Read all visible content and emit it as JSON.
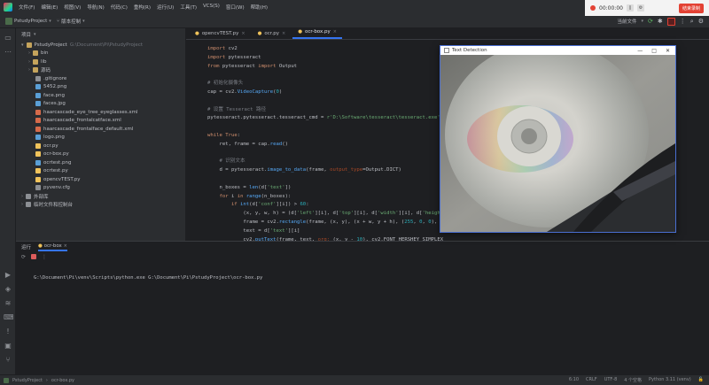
{
  "menu": {
    "items": [
      "文件(F)",
      "编辑(E)",
      "视图(V)",
      "导航(N)",
      "代码(C)",
      "重构(R)",
      "运行(U)",
      "工具(T)",
      "VCS(S)",
      "窗口(W)",
      "帮助(H)"
    ]
  },
  "toolbar": {
    "project": "PstudyProject",
    "vcs": "版本控制"
  },
  "recorder": {
    "time": "00:00:00",
    "stop_label": "结束录制"
  },
  "run_config": "当前文件",
  "project_panel": {
    "header": "项目",
    "root_name": "PstudyProject",
    "root_path": "G:\\Document\\Pi\\PstudyProject",
    "items": [
      {
        "label": "bin",
        "type": "folder"
      },
      {
        "label": "lib",
        "type": "folder"
      },
      {
        "label": "源码",
        "type": "folder"
      },
      {
        "label": ".gitignore",
        "type": "file"
      },
      {
        "label": "5452.png",
        "type": "img"
      },
      {
        "label": "face.png",
        "type": "img"
      },
      {
        "label": "faces.jpg",
        "type": "img"
      },
      {
        "label": "haarcascade_eye_tree_eyeglasses.xml",
        "type": "xml"
      },
      {
        "label": "haarcascade_frontalcatface.xml",
        "type": "xml"
      },
      {
        "label": "haarcascade_frontalface_default.xml",
        "type": "xml"
      },
      {
        "label": "logo.png",
        "type": "img"
      },
      {
        "label": "ocr.py",
        "type": "py"
      },
      {
        "label": "ocr-box.py",
        "type": "py"
      },
      {
        "label": "ocrtest.png",
        "type": "img"
      },
      {
        "label": "ocrtest.py",
        "type": "py"
      },
      {
        "label": "opencvTEST.py",
        "type": "py"
      },
      {
        "label": "pyvenv.cfg",
        "type": "cfg"
      }
    ],
    "external": "外部库",
    "scratches": "临时文件和控制台"
  },
  "editor": {
    "tabs": [
      {
        "label": "opencvTEST.py",
        "active": false
      },
      {
        "label": "ocr.py",
        "active": false
      },
      {
        "label": "ocr-box.py",
        "active": true
      }
    ],
    "lines": [
      [
        {
          "c": "kw",
          "t": "import "
        },
        {
          "c": "id",
          "t": "cv2"
        }
      ],
      [
        {
          "c": "kw",
          "t": "import "
        },
        {
          "c": "id",
          "t": "pytesseract"
        }
      ],
      [
        {
          "c": "kw",
          "t": "from "
        },
        {
          "c": "id",
          "t": "pytesseract "
        },
        {
          "c": "kw",
          "t": "import "
        },
        {
          "c": "id",
          "t": "Output"
        }
      ],
      [],
      [
        {
          "c": "cm",
          "t": "# 初始化摄像头"
        }
      ],
      [
        {
          "c": "id",
          "t": "cap = cv2."
        },
        {
          "c": "fn",
          "t": "VideoCapture"
        },
        {
          "c": "id",
          "t": "("
        },
        {
          "c": "num",
          "t": "0"
        },
        {
          "c": "id",
          "t": ")"
        }
      ],
      [],
      [
        {
          "c": "cm",
          "t": "# 设置 Tesseract 路径"
        }
      ],
      [
        {
          "c": "id",
          "t": "pytesseract.pytesseract.tesseract_cmd = "
        },
        {
          "c": "str",
          "t": "r'D:\\Software\\tesseract\\tesseract.exe'"
        }
      ],
      [],
      [
        {
          "c": "kw",
          "t": "while "
        },
        {
          "c": "kw",
          "t": "True"
        },
        {
          "c": "id",
          "t": ":"
        }
      ],
      [
        {
          "c": "id",
          "t": "    ret, frame = cap."
        },
        {
          "c": "fn",
          "t": "read"
        },
        {
          "c": "id",
          "t": "()"
        }
      ],
      [],
      [
        {
          "c": "cm",
          "t": "    # 识别文本"
        }
      ],
      [
        {
          "c": "id",
          "t": "    d = pytesseract."
        },
        {
          "c": "fn",
          "t": "image_to_data"
        },
        {
          "c": "id",
          "t": "(frame, "
        },
        {
          "c": "prm",
          "t": "output_type"
        },
        {
          "c": "id",
          "t": "=Output.DICT)"
        }
      ],
      [],
      [
        {
          "c": "id",
          "t": "    n_boxes = "
        },
        {
          "c": "fn",
          "t": "len"
        },
        {
          "c": "id",
          "t": "(d["
        },
        {
          "c": "str",
          "t": "'text'"
        },
        {
          "c": "id",
          "t": "])"
        }
      ],
      [
        {
          "c": "kw",
          "t": "    for "
        },
        {
          "c": "id",
          "t": "i "
        },
        {
          "c": "kw",
          "t": "in "
        },
        {
          "c": "fn",
          "t": "range"
        },
        {
          "c": "id",
          "t": "(n_boxes):"
        }
      ],
      [
        {
          "c": "kw",
          "t": "        if "
        },
        {
          "c": "fn",
          "t": "int"
        },
        {
          "c": "id",
          "t": "(d["
        },
        {
          "c": "str",
          "t": "'conf'"
        },
        {
          "c": "id",
          "t": "][i]) > "
        },
        {
          "c": "num",
          "t": "60"
        },
        {
          "c": "id",
          "t": ":"
        }
      ],
      [
        {
          "c": "id",
          "t": "            (x, y, w, h) = (d["
        },
        {
          "c": "str",
          "t": "'left'"
        },
        {
          "c": "id",
          "t": "][i], d["
        },
        {
          "c": "str",
          "t": "'top'"
        },
        {
          "c": "id",
          "t": "][i], d["
        },
        {
          "c": "str",
          "t": "'width'"
        },
        {
          "c": "id",
          "t": "][i], d["
        },
        {
          "c": "str",
          "t": "'height'"
        },
        {
          "c": "id",
          "t": "][i])"
        }
      ],
      [
        {
          "c": "id",
          "t": "            frame = cv2."
        },
        {
          "c": "fn",
          "t": "rectangle"
        },
        {
          "c": "id",
          "t": "(frame, (x, y), (x + w, y + h), ("
        },
        {
          "c": "num",
          "t": "255"
        },
        {
          "c": "id",
          "t": ", "
        },
        {
          "c": "num",
          "t": "0"
        },
        {
          "c": "id",
          "t": ", "
        },
        {
          "c": "num",
          "t": "0"
        },
        {
          "c": "id",
          "t": "), "
        },
        {
          "c": "num",
          "t": "2"
        },
        {
          "c": "id",
          "t": ")"
        }
      ],
      [
        {
          "c": "id",
          "t": "            text = d["
        },
        {
          "c": "str",
          "t": "'text'"
        },
        {
          "c": "id",
          "t": "][i]"
        }
      ],
      [
        {
          "c": "id",
          "t": "            cv2."
        },
        {
          "c": "fn",
          "t": "putText"
        },
        {
          "c": "id",
          "t": "(frame, text, "
        },
        {
          "c": "prm",
          "t": "org: "
        },
        {
          "c": "id",
          "t": "(x, y - "
        },
        {
          "c": "num",
          "t": "10"
        },
        {
          "c": "id",
          "t": "), cv2.FONT_HERSHEY_SIMPLEX"
        }
      ]
    ]
  },
  "bottom": {
    "tab_run": "运行",
    "tab_file": "ocr-box",
    "command": "G:\\Document\\Pi\\venv\\Scripts\\python.exe G:\\Document\\Pi\\PstudyProject\\ocr-box.py"
  },
  "status": {
    "breadcrumb_project": "PstudyProject",
    "breadcrumb_file": "ocr-box.py",
    "position": "6:10",
    "line_sep": "CRLF",
    "encoding": "UTF-8",
    "indent": "4 个空格",
    "interpreter": "Python 3.11 (venv)"
  },
  "text_window": {
    "title": "Text Detection"
  },
  "colors": {
    "accent": "#3574f0",
    "window_border": "#4a6fd2",
    "record_red": "#e34234"
  }
}
